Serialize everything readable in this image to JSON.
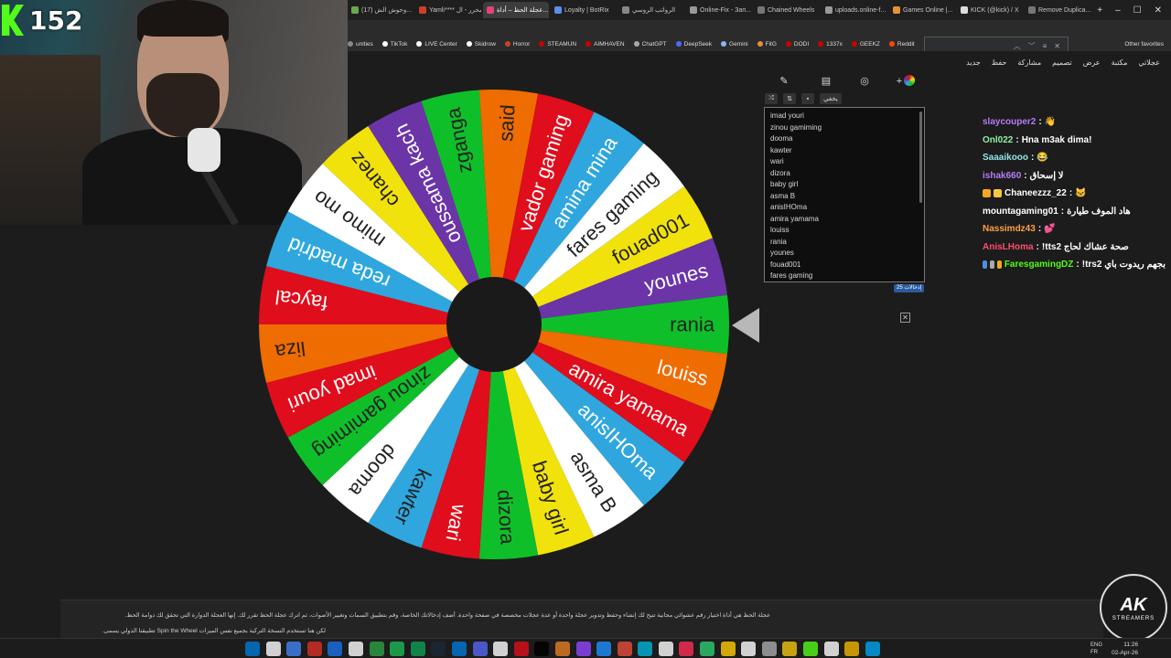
{
  "stream": {
    "viewer_count": "152"
  },
  "browser": {
    "tabs": [
      {
        "label": "(17) وحوش الش...",
        "active": false,
        "color": "#6aa84f"
      },
      {
        "label": "Yamli**** محرر - ال...",
        "active": false,
        "color": "#cc4125"
      },
      {
        "label": "عجلة الحظ – أداة...",
        "active": true,
        "color": "#e0457b"
      },
      {
        "label": "Loyalty | BotRix",
        "active": false,
        "color": "#5b8def"
      },
      {
        "label": "الرواتب الروسي",
        "active": false,
        "color": "#888888"
      },
      {
        "label": "Online-Fix - Зап...",
        "active": false,
        "color": "#999999"
      },
      {
        "label": "Chained Wheels",
        "active": false,
        "color": "#777777"
      },
      {
        "label": "uploads.online-f...",
        "active": false,
        "color": "#999999"
      },
      {
        "label": "Games Online |...",
        "active": false,
        "color": "#e69138"
      },
      {
        "label": "KICK (@kick) / X",
        "active": false,
        "color": "#dddddd"
      },
      {
        "label": "Remove Duplica...",
        "active": false,
        "color": "#777777"
      }
    ],
    "bookmarks": [
      {
        "label": "unities",
        "color": "#888888"
      },
      {
        "label": "TikTok",
        "color": "#ffffff"
      },
      {
        "label": "LIVE Center",
        "color": "#ffffff"
      },
      {
        "label": "Skidrow",
        "color": "#ffffff"
      },
      {
        "label": "Horror",
        "color": "#cc4125"
      },
      {
        "label": "STEAMUN",
        "color": "#cc0000"
      },
      {
        "label": "AIMHAVEN",
        "color": "#cc0000"
      },
      {
        "label": "ChatGPT",
        "color": "#aaaaaa"
      },
      {
        "label": "DeepSeek",
        "color": "#4d6bfe"
      },
      {
        "label": "Gemini",
        "color": "#8ab4f8"
      },
      {
        "label": "FitG",
        "color": "#e69138"
      },
      {
        "label": "DODI",
        "color": "#cc0000"
      },
      {
        "label": "1337x",
        "color": "#cc0000"
      },
      {
        "label": "GEEKZ",
        "color": "#cc0000"
      },
      {
        "label": "Reddit",
        "color": "#ff4500"
      }
    ],
    "other_favorites": "Other favorites"
  },
  "site_toolbar": [
    "عجلاتي",
    "مكتبة",
    "عرض",
    "تصميم",
    "مشاركة",
    "حفظ",
    "جديد"
  ],
  "wheel": {
    "entries": [
      "rania",
      "louiss",
      "amira yamama",
      "anisIHOma",
      "asma B",
      "baby girl",
      "dizora",
      "wari",
      "kawter",
      "dooma",
      "zinou gamiming",
      "imad youri",
      "liza",
      "faycal",
      "reda madrid",
      "mimo mo",
      "chanez",
      "oussama kach",
      "zganga",
      "said",
      "vador gaming",
      "amina mina",
      "fares gaming",
      "fouad001",
      "younes"
    ],
    "colors": [
      "#0fbf2a",
      "#ef6c00",
      "#e00d1c",
      "#2fa7de",
      "#ffffff",
      "#f2e20c",
      "#0fbf2a",
      "#e00d1c",
      "#2fa7de",
      "#ffffff",
      "#0fbf2a",
      "#e00d1c",
      "#ef6c00",
      "#e00d1c",
      "#2fa7de",
      "#ffffff",
      "#f2e20c",
      "#6b35a8",
      "#0fbf2a",
      "#ef6c00",
      "#e00d1c",
      "#2fa7de",
      "#ffffff",
      "#f2e20c",
      "#6b35a8"
    ],
    "text_colors": [
      "#222222",
      "#ffffff",
      "#ffffff",
      "#ffffff",
      "#222222",
      "#222222",
      "#222222",
      "#ffffff",
      "#222222",
      "#222222",
      "#222222",
      "#ffffff",
      "#222222",
      "#ffffff",
      "#ffffff",
      "#222222",
      "#222222",
      "#ffffff",
      "#222222",
      "#222222",
      "#ffffff",
      "#ffffff",
      "#222222",
      "#222222",
      "#ffffff"
    ]
  },
  "entry_list": {
    "shuffle_label": "يخفي",
    "items": [
      "imad youri",
      "zinou gamiming",
      "dooma",
      "kawter",
      "wari",
      "dizora",
      "baby girl",
      "asma B",
      "anisIHOma",
      "amira yamama",
      "louiss",
      "rania",
      "younes",
      "fouad001",
      "fares gaming"
    ],
    "count_badge": "25 إدخالات"
  },
  "chat": [
    {
      "user": "slaycouper2",
      "user_color": "#b57cf5",
      "text": "👋",
      "badges": []
    },
    {
      "user": "Onl022",
      "user_color": "#8ef0a3",
      "text": "Hna m3ak dima!",
      "badges": []
    },
    {
      "user": "Saaaikooo",
      "user_color": "#8fe5e5",
      "text": "😂",
      "badges": []
    },
    {
      "user": "ishak660",
      "user_color": "#b57cf5",
      "text": "لا إسحاق",
      "badges": []
    },
    {
      "user": "Chaneezzz_22",
      "user_color": "#ffffff",
      "text": "🐱",
      "badges": [
        "#f5a623",
        "#f5c842"
      ]
    },
    {
      "user": "mountagaming01",
      "user_color": "#ffffff",
      "text": "هاد الموف طيارة",
      "badges": []
    },
    {
      "user": "Nassimdz43",
      "user_color": "#ff9f43",
      "text": "💕",
      "badges": []
    },
    {
      "user": "AnisLHoma",
      "user_color": "#ff4d6d",
      "text": "!tts2 صحة عشاك لحاج",
      "badges": []
    },
    {
      "user": "FaresgamingDZ",
      "user_color": "#53fc18",
      "text": "!trs2 بجهم ريدوت باي",
      "badges": [
        "#4a90e2",
        "#aaaaaa",
        "#f5a623"
      ]
    }
  ],
  "footer": {
    "line1": "عجلة الحظ هي أداة اختيار رقم عشوائي مجانية تتيح لك إنشاء وحفظ وتدوير عجلة واحدة أو عدة عجلات مخصصة في صفحة واحدة. أضف إدخالاتك الخاصة، وقم بتطبيق السمات وتغيير الأصوات، ثم اترك عجلة الحظ تقرر لك. إنها العجلة الدوارة التي تحقق لك دوامة الحظ.",
    "line2": "لكن هنا تستخدم النسخة التركية بجميع نفس الميزات Spin the Wheel تطبيقنا الدولي يسمى."
  },
  "logo": {
    "big": "AK",
    "small": "STREAMERS"
  },
  "taskbar": {
    "lang": "ENG",
    "lang2": "FR",
    "time": "11:26",
    "date": "02-Apr-26"
  }
}
